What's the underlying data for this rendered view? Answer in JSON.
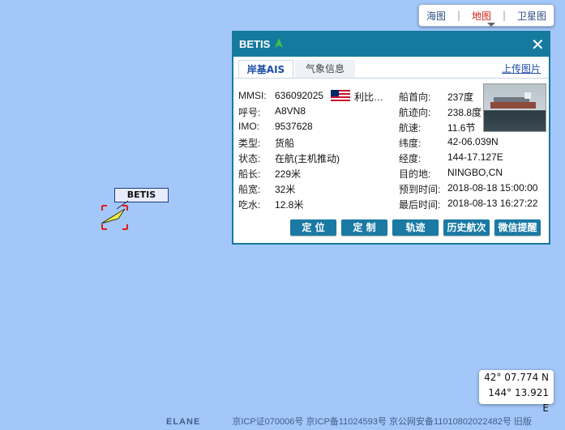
{
  "map_type": {
    "sea": "海图",
    "map": "地图",
    "satellite": "卫星图",
    "active": "map"
  },
  "ship_marker": {
    "label": "BETIS"
  },
  "popup": {
    "title": "BETIS",
    "tabs": [
      "岸基AIS",
      "气象信息"
    ],
    "upload_link": "上传图片",
    "left_fields": [
      {
        "label": "MMSI:",
        "value": "636092025",
        "flag": "利比…"
      },
      {
        "label": "呼号:",
        "value": "A8VN8"
      },
      {
        "label": "IMO:",
        "value": "9537628"
      },
      {
        "label": "类型:",
        "value": "货船"
      },
      {
        "label": "状态:",
        "value": "在航(主机推动)"
      },
      {
        "label": "船长:",
        "value": "229米"
      },
      {
        "label": "船宽:",
        "value": "32米"
      },
      {
        "label": "吃水:",
        "value": "12.8米"
      }
    ],
    "right_fields": [
      {
        "label": "船首向:",
        "value": "237度"
      },
      {
        "label": "航迹向:",
        "value": "238.8度"
      },
      {
        "label": "航速:",
        "value": "11.6节"
      },
      {
        "label": "纬度:",
        "value": "42-06.039N"
      },
      {
        "label": "经度:",
        "value": "144-17.127E"
      },
      {
        "label": "目的地:",
        "value": "NINGBO,CN"
      },
      {
        "label": "预到时间:",
        "value": "2018-08-18 15:00:00"
      },
      {
        "label": "最后时间:",
        "value": "2018-08-13 16:27:22"
      }
    ],
    "buttons": [
      "定 位",
      "定 制",
      "轨迹",
      "历史航次",
      "微信提醒"
    ]
  },
  "coords": {
    "lat": "42° 07.774 N",
    "lon": "144° 13.921 E"
  },
  "footer": {
    "brand": "ELANE",
    "icp1": "京ICP证070006号",
    "icp2": "京ICP备11024593号",
    "icp3": "京公网安备11010802022482号",
    "old": "旧版"
  },
  "colors": {
    "ocean": "#a3c7f9",
    "popup_accent": "#157a9e",
    "active_tab": "#d9221c"
  }
}
